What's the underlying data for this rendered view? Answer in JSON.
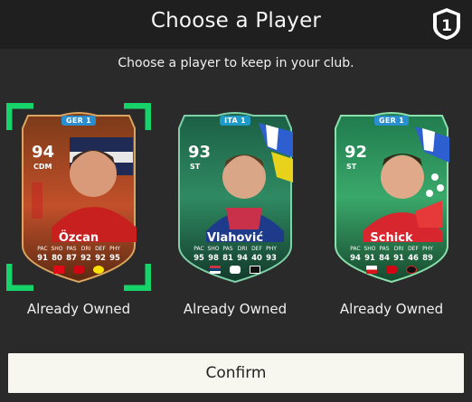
{
  "dialog": {
    "title": "Choose a Player",
    "subtitle": "Choose a player to keep in your club."
  },
  "players": [
    {
      "name": "Özcan",
      "rating": "94",
      "position": "CDM",
      "league": "GER 1",
      "stat_labels": [
        "PAC",
        "SHO",
        "PAS",
        "DRI",
        "DEF",
        "PHY"
      ],
      "stats": [
        "91",
        "80",
        "87",
        "92",
        "92",
        "95"
      ],
      "status": "Already Owned",
      "selected": true,
      "card_color": "#b5451e",
      "nation": "turkey-flag",
      "league_icon": "bundesliga-icon",
      "club": "dortmund-badge"
    },
    {
      "name": "Vlahović",
      "rating": "93",
      "position": "ST",
      "league": "ITA 1",
      "stat_labels": [
        "PAC",
        "SHO",
        "PAS",
        "DRI",
        "DEF",
        "PHY"
      ],
      "stats": [
        "95",
        "98",
        "81",
        "94",
        "40",
        "93"
      ],
      "status": "Already Owned",
      "selected": false,
      "card_color": "#1f7a55",
      "nation": "serbia-flag",
      "league_icon": "serie-a-icon",
      "club": "juventus-badge"
    },
    {
      "name": "Schick",
      "rating": "92",
      "position": "ST",
      "league": "GER 1",
      "stat_labels": [
        "PAC",
        "SHO",
        "PAS",
        "DRI",
        "DEF",
        "PHY"
      ],
      "stats": [
        "94",
        "91",
        "84",
        "91",
        "46",
        "89"
      ],
      "status": "Already Owned",
      "selected": false,
      "card_color": "#2a9a5c",
      "nation": "czech-flag",
      "league_icon": "bundesliga-icon",
      "club": "leverkusen-badge"
    }
  ],
  "actions": {
    "confirm_label": "Confirm"
  },
  "colors": {
    "selection": "#16d36a",
    "header_bg": "#1f1f1f",
    "body_bg": "#2a2a2a",
    "confirm_bg": "#f7f6ef"
  }
}
